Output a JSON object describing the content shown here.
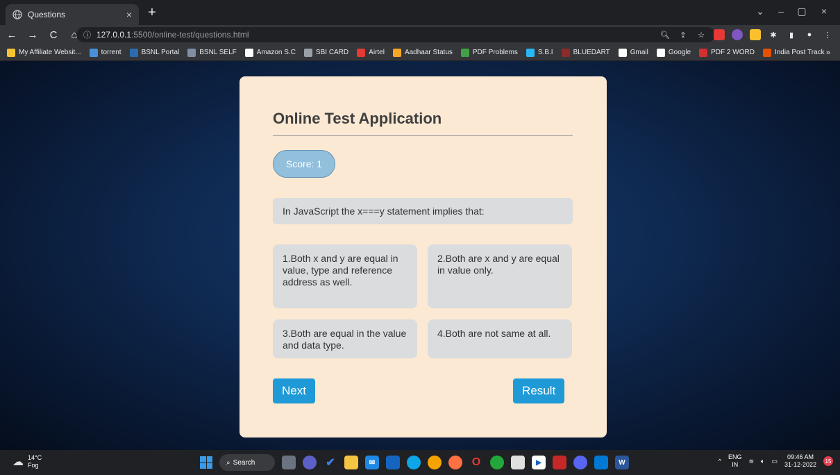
{
  "browser": {
    "tab_title": "Questions",
    "tab_close": "×",
    "new_tab": "+",
    "back": "←",
    "forward": "→",
    "reload": "C",
    "home": "⌂",
    "url_host": "127.0.0.1",
    "url_path": ":5500/online-test/questions.html",
    "min": "–",
    "restore": "▢",
    "close": "×",
    "tab_search": "⌄"
  },
  "bookmarks": [
    {
      "label": "My Affiliate Websit...",
      "color": "#f4c430"
    },
    {
      "label": "torrent",
      "color": "#4a90d9"
    },
    {
      "label": "BSNL Portal",
      "color": "#2b6cb0"
    },
    {
      "label": "BSNL SELF",
      "color": "#7f8fa6"
    },
    {
      "label": "Amazon S.C",
      "color": "#ffffff"
    },
    {
      "label": "SBI CARD",
      "color": "#9aa0a6"
    },
    {
      "label": "Airtel",
      "color": "#e53935"
    },
    {
      "label": "Aadhaar Status",
      "color": "#f6a623"
    },
    {
      "label": "PDF Problems",
      "color": "#43a047"
    },
    {
      "label": "S.B.I",
      "color": "#29b6f6"
    },
    {
      "label": "BLUEDART",
      "color": "#8e2a2a"
    },
    {
      "label": "Gmail",
      "color": "#ffffff"
    },
    {
      "label": "Google",
      "color": "#ffffff"
    },
    {
      "label": "PDF 2 WORD",
      "color": "#d32f2f"
    },
    {
      "label": "India Post Track",
      "color": "#e65100"
    }
  ],
  "bookmarks_more": "»",
  "app": {
    "title": "Online Test Application",
    "score": "Score: 1",
    "question": "In JavaScript the x===y statement implies that:",
    "options": [
      "1.Both x and y are equal in value, type and reference address as well.",
      "2.Both are x and y are equal in value only.",
      "3.Both are equal in the value and data type.",
      "4.Both are not same at all."
    ],
    "next_label": "Next",
    "result_label": "Result"
  },
  "taskbar": {
    "temperature": "14°C",
    "weather": "Fog",
    "search_label": "Search",
    "language": "ENG",
    "region": "IN",
    "time": "09:46 AM",
    "date": "31-12-2022",
    "notifications": "15"
  },
  "colors": {
    "card_bg": "#fbe9d4",
    "accent": "#1f9ad6",
    "score_bg": "#91bfdc",
    "option_bg": "#dadcdd"
  }
}
